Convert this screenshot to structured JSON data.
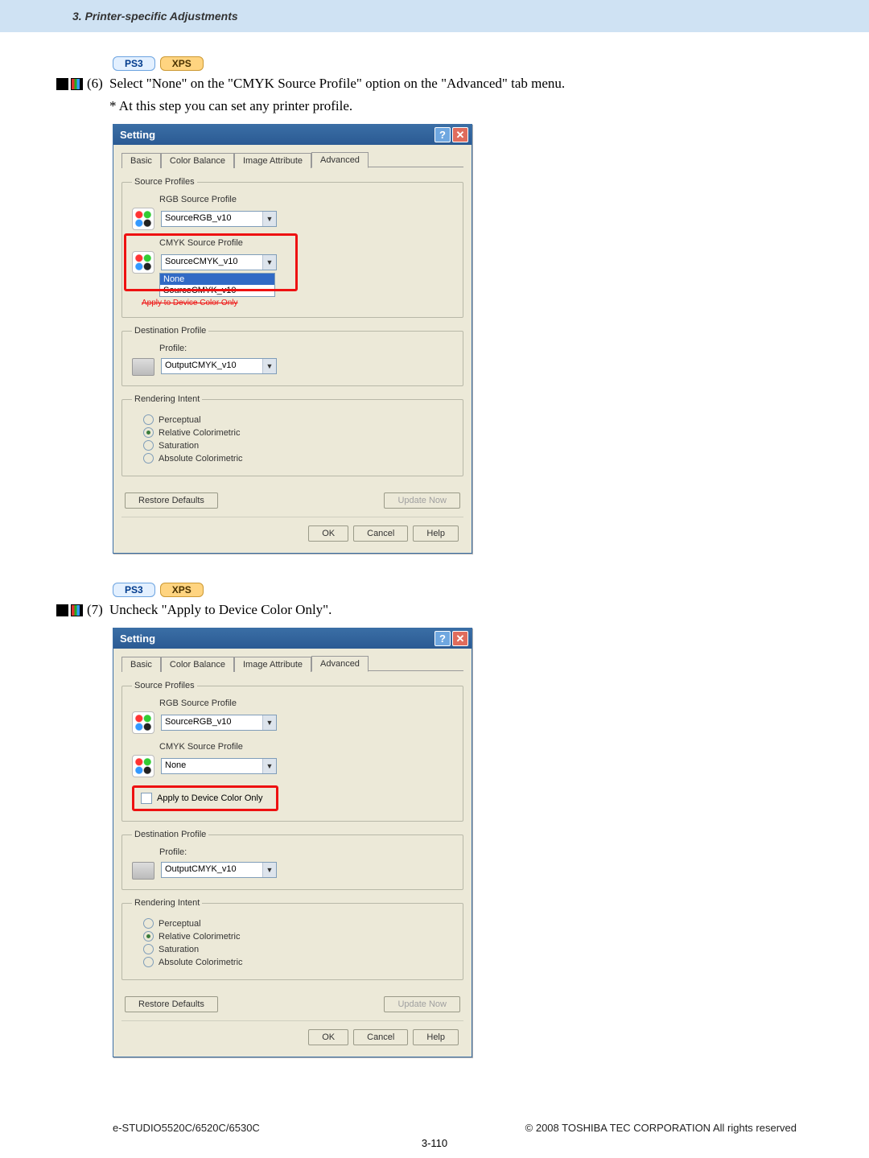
{
  "header": {
    "breadcrumb": "3. Printer-specific Adjustments"
  },
  "badges": {
    "ps3": "PS3",
    "xps": "XPS"
  },
  "step6": {
    "num": "(6)",
    "text": "Select \"None\" on the \"CMYK Source Profile\" option on the \"Advanced\" tab menu.",
    "note": "* At this step you can set any printer profile."
  },
  "step7": {
    "num": "(7)",
    "text": "Uncheck \"Apply to Device Color Only\"."
  },
  "dialog": {
    "title": "Setting",
    "tabs": {
      "basic": "Basic",
      "color_balance": "Color Balance",
      "image_attr": "Image Attribute",
      "advanced": "Advanced"
    },
    "source_profiles": {
      "legend": "Source Profiles",
      "rgb_label": "RGB Source Profile",
      "rgb_value": "SourceRGB_v10",
      "cmyk_label": "CMYK Source Profile",
      "cmyk_value_a": "SourceCMYK_v10",
      "cmyk_value_b": "None",
      "dd_none": "None",
      "dd_scmyk": "SourceCMYK_v10",
      "apply_strike": "Apply to Device Color Only"
    },
    "apply_checkbox": "Apply to Device Color Only",
    "dest_profile": {
      "legend": "Destination Profile",
      "profile_label": "Profile:",
      "value": "OutputCMYK_v10"
    },
    "rendering": {
      "legend": "Rendering Intent",
      "perceptual": "Perceptual",
      "relative": "Relative Colorimetric",
      "saturation": "Saturation",
      "absolute": "Absolute Colorimetric"
    },
    "buttons": {
      "restore": "Restore Defaults",
      "update": "Update Now",
      "ok": "OK",
      "cancel": "Cancel",
      "help": "Help"
    }
  },
  "footer": {
    "left": "e-STUDIO5520C/6520C/6530C",
    "right": "© 2008 TOSHIBA TEC CORPORATION All rights reserved",
    "page": "3-110"
  }
}
